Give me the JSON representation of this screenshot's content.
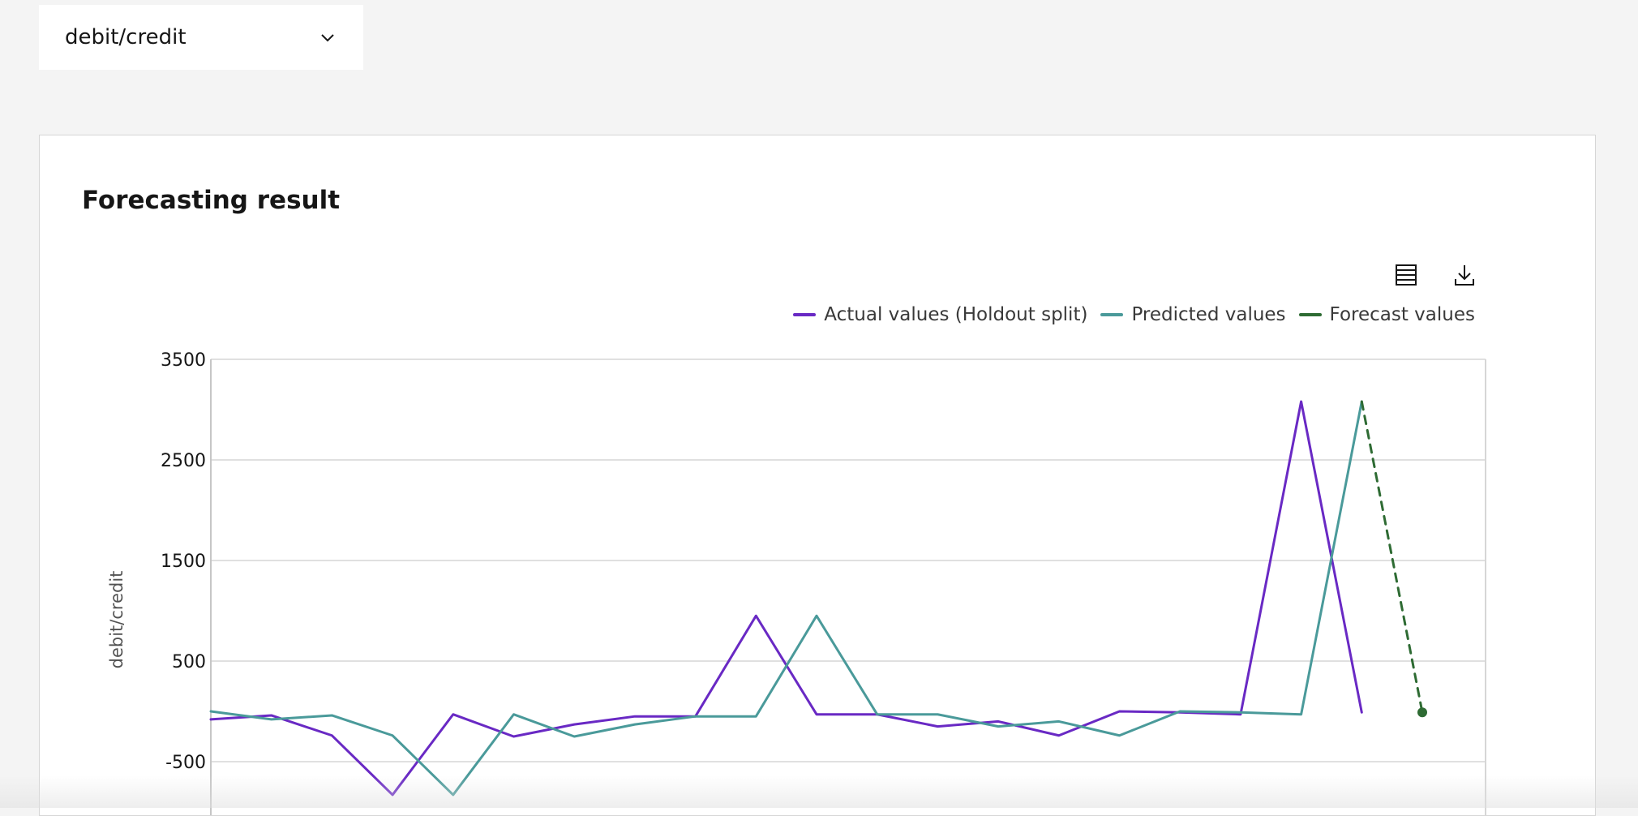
{
  "dropdown": {
    "selected": "debit/credit"
  },
  "card": {
    "title": "Forecasting result"
  },
  "toolbar": {
    "table_icon": "table-view-icon",
    "download_icon": "download-icon"
  },
  "colors": {
    "actual": "#6929c4",
    "predicted": "#4a9a9a",
    "forecast": "#2e6b33",
    "grid": "#e0e0e0"
  },
  "legend": [
    "Actual values (Holdout split)",
    "Predicted values",
    "Forecast values"
  ],
  "chart_data": {
    "type": "line",
    "ylabel": "debit/credit",
    "ylim": [
      -800,
      3500
    ],
    "yticks": [
      "3500",
      "2500",
      "1500",
      "500",
      "-500"
    ],
    "grid": true,
    "legend_position": "top-right",
    "x_count": 21,
    "series": [
      {
        "name": "Actual values (Holdout split)",
        "style": "solid",
        "x": [
          0,
          1,
          2,
          3,
          4,
          5,
          6,
          7,
          8,
          9,
          10,
          11,
          12,
          13,
          14,
          15,
          16,
          17,
          18,
          19
        ],
        "values": [
          -80,
          -40,
          -240,
          -830,
          -30,
          -250,
          -130,
          -50,
          -50,
          950,
          -30,
          -30,
          -150,
          -100,
          -240,
          0,
          -10,
          -30,
          3080,
          -10
        ]
      },
      {
        "name": "Predicted values",
        "style": "solid",
        "x": [
          0,
          1,
          2,
          3,
          4,
          5,
          6,
          7,
          8,
          9,
          10,
          11,
          12,
          13,
          14,
          15,
          16,
          17,
          18,
          19
        ],
        "values": [
          0,
          -80,
          -40,
          -240,
          -830,
          -30,
          -250,
          -130,
          -50,
          -50,
          950,
          -30,
          -30,
          -150,
          -100,
          -240,
          0,
          -10,
          -30,
          3080
        ]
      },
      {
        "name": "Forecast values",
        "style": "dashed",
        "x": [
          19,
          20
        ],
        "values": [
          3080,
          -10
        ]
      }
    ]
  }
}
